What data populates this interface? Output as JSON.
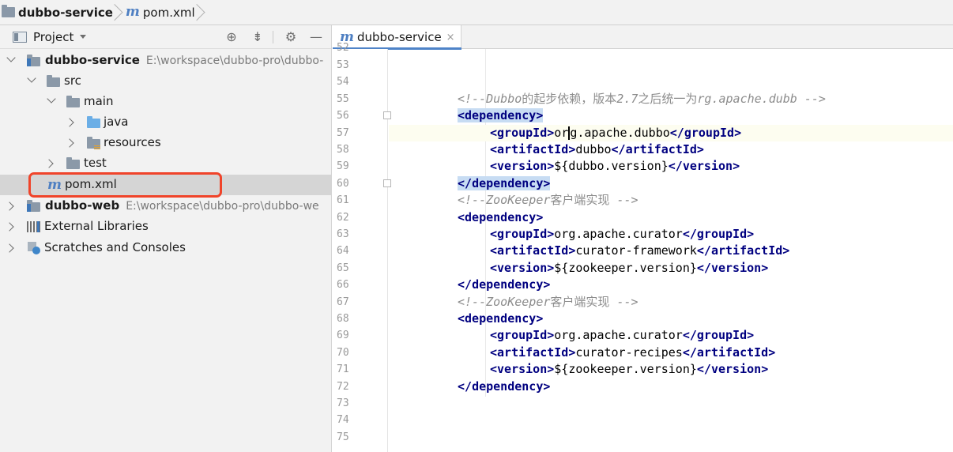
{
  "breadcrumb": {
    "project": "dubbo-service",
    "file": "pom.xml",
    "file_icon": "m"
  },
  "project_panel": {
    "title": "Project",
    "tools": [
      "crosshair-icon",
      "collapse-icon",
      "gear-icon",
      "minimize-icon"
    ],
    "tree": [
      {
        "id": "dubbo-service",
        "label": "dubbo-service",
        "path": "E:\\workspace\\dubbo-pro\\dubbo-",
        "expanded": true,
        "bold": true,
        "icon": "module-folder-icon"
      },
      {
        "id": "src",
        "label": "src",
        "expanded": true,
        "icon": "folder-icon"
      },
      {
        "id": "main",
        "label": "main",
        "expanded": true,
        "icon": "folder-icon"
      },
      {
        "id": "java",
        "label": "java",
        "expanded": false,
        "icon": "source-folder-icon"
      },
      {
        "id": "resources",
        "label": "resources",
        "expanded": false,
        "icon": "resources-folder-icon"
      },
      {
        "id": "test",
        "label": "test",
        "expanded": false,
        "icon": "folder-icon"
      },
      {
        "id": "pom",
        "label": "pom.xml",
        "icon": "maven-icon",
        "icon_text": "m",
        "selected": true
      },
      {
        "id": "dubbo-web",
        "label": "dubbo-web",
        "path": "E:\\workspace\\dubbo-pro\\dubbo-we",
        "expanded": false,
        "bold": true,
        "icon": "module-folder-icon"
      },
      {
        "id": "ext-libs",
        "label": "External Libraries",
        "expanded": false,
        "icon": "libraries-icon"
      },
      {
        "id": "scratches",
        "label": "Scratches and Consoles",
        "expanded": false,
        "icon": "scratches-icon"
      }
    ]
  },
  "editor": {
    "tab": {
      "label": "dubbo-service",
      "icon_text": "m",
      "close": "×"
    },
    "top_partial_line_number": "52",
    "lines": [
      {
        "n": "53",
        "text": ""
      },
      {
        "n": "54",
        "text": ""
      },
      {
        "n": "55",
        "text": "<!--Dubbo的起步依赖，版本2.7之后统一为rg.apache.dubb -->"
      },
      {
        "n": "56",
        "text": "<dependency>"
      },
      {
        "n": "57",
        "text": "<groupId>org.apache.dubbo</groupId>"
      },
      {
        "n": "58",
        "text": "<artifactId>dubbo</artifactId>"
      },
      {
        "n": "59",
        "text": "<version>${dubbo.version}</version>"
      },
      {
        "n": "60",
        "text": "</dependency>"
      },
      {
        "n": "61",
        "text": "<!--ZooKeeper客户端实现 -->"
      },
      {
        "n": "62",
        "text": "<dependency>"
      },
      {
        "n": "63",
        "text": "<groupId>org.apache.curator</groupId>"
      },
      {
        "n": "64",
        "text": "<artifactId>curator-framework</artifactId>"
      },
      {
        "n": "65",
        "text": "<version>${zookeeper.version}</version>"
      },
      {
        "n": "66",
        "text": "</dependency>"
      },
      {
        "n": "67",
        "text": "<!--ZooKeeper客户端实现 -->"
      },
      {
        "n": "68",
        "text": "<dependency>"
      },
      {
        "n": "69",
        "text": "<groupId>org.apache.curator</groupId>"
      },
      {
        "n": "70",
        "text": "<artifactId>curator-recipes</artifactId>"
      },
      {
        "n": "71",
        "text": "<version>${zookeeper.version}</version>"
      },
      {
        "n": "72",
        "text": "</dependency>"
      },
      {
        "n": "73",
        "text": ""
      },
      {
        "n": "74",
        "text": ""
      },
      {
        "n": "75",
        "text": ""
      }
    ],
    "current_line": "57",
    "highlighted_tag_lines": [
      "56",
      "60"
    ]
  },
  "colors": {
    "tag": "#000080",
    "comment": "#8c8c8c",
    "annotation_box": "#f0442a",
    "tab_underline": "#4e83c8"
  }
}
